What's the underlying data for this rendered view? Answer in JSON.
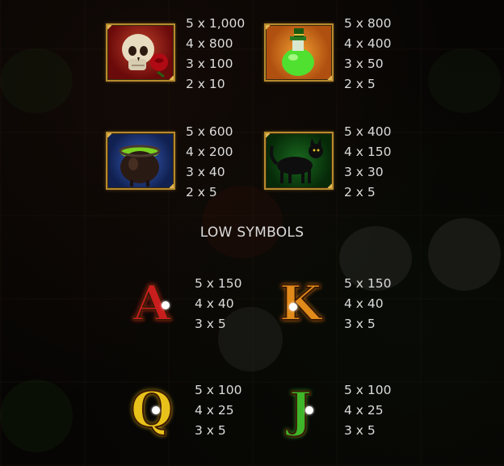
{
  "high_symbols": [
    {
      "name": "skull-rose",
      "pays": [
        "5 x 1,000",
        "4 x 800",
        "3 x 100",
        "2 x 10"
      ]
    },
    {
      "name": "green-potion",
      "pays": [
        "5 x 800",
        "4 x 400",
        "3 x 50",
        "2 x 5"
      ]
    },
    {
      "name": "cauldron",
      "pays": [
        "5 x 600",
        "4 x 200",
        "3 x 40",
        "2 x 5"
      ]
    },
    {
      "name": "black-cat",
      "pays": [
        "5 x 400",
        "4 x 150",
        "3 x 30",
        "2 x 5"
      ]
    }
  ],
  "low_header": "LOW SYMBOLS",
  "low_symbols": [
    {
      "letter": "A",
      "color": "#c81e1e",
      "pays": [
        "5 x 150",
        "4 x 40",
        "3 x 5"
      ]
    },
    {
      "letter": "K",
      "color": "#e08a1a",
      "pays": [
        "5 x 150",
        "4 x 40",
        "3 x 5"
      ]
    },
    {
      "letter": "Q",
      "color": "#e8c21a",
      "pays": [
        "5 x 100",
        "4 x 25",
        "3 x 5"
      ]
    },
    {
      "letter": "J",
      "color": "#3fb52a",
      "pays": [
        "5 x 100",
        "4 x 25",
        "3 x 5"
      ]
    }
  ]
}
